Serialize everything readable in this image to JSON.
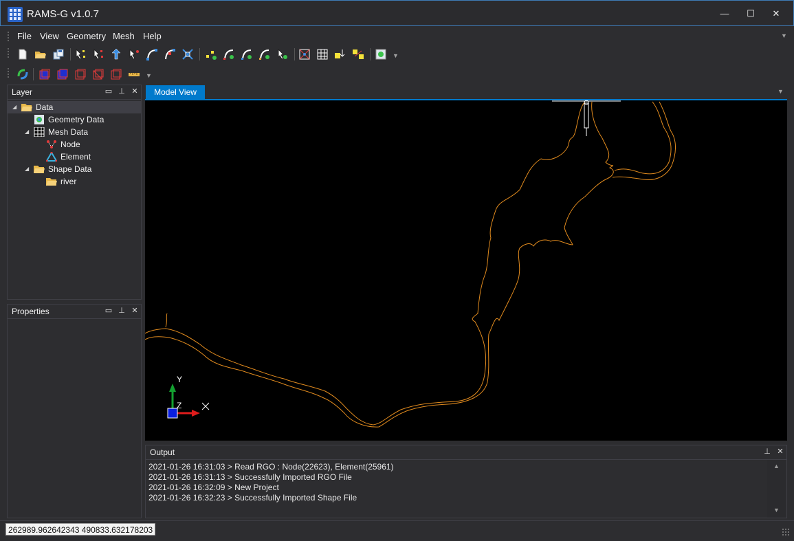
{
  "window": {
    "title": "RAMS-G v1.0.7",
    "min_glyph": "—",
    "max_glyph": "☐",
    "close_glyph": "✕"
  },
  "menu": {
    "items": [
      "File",
      "View",
      "Geometry",
      "Mesh",
      "Help"
    ]
  },
  "toolbar": {
    "row1_icons": [
      "new-file-icon",
      "open-folder-icon",
      "save-icon",
      "select-node-icon",
      "deselect-node-icon",
      "move-node-icon",
      "edit-node-icon",
      "add-line-icon",
      "split-line-icon",
      "delete-line-icon",
      "add-point-icon",
      "curve-add-icon",
      "curve-edit-icon",
      "curve-merge-icon",
      "curve-delete-icon",
      "mesh-region-icon",
      "mesh-grid-icon",
      "mesh-import-icon",
      "mesh-export-icon",
      "map-view-icon"
    ],
    "row2_icons": [
      "refresh-icon",
      "layer-blue-1-icon",
      "layer-blue-2-icon",
      "layer-red-1-icon",
      "layer-red-2-icon",
      "layer-red-3-icon",
      "ruler-icon"
    ]
  },
  "layer_panel": {
    "title": "Layer",
    "tree": [
      {
        "label": "Data",
        "level": 0,
        "expanded": true,
        "icon": "folder-open-icon",
        "selected": true
      },
      {
        "label": "Geometry Data",
        "level": 1,
        "icon": "geometry-icon"
      },
      {
        "label": "Mesh Data",
        "level": 1,
        "expanded": true,
        "icon": "mesh-icon"
      },
      {
        "label": "Node",
        "level": 2,
        "icon": "node-icon"
      },
      {
        "label": "Element",
        "level": 2,
        "icon": "element-icon"
      },
      {
        "label": "Shape Data",
        "level": 1,
        "expanded": true,
        "icon": "folder-open-icon"
      },
      {
        "label": "river",
        "level": 2,
        "icon": "folder-icon"
      }
    ]
  },
  "properties_panel": {
    "title": "Properties"
  },
  "model_view": {
    "tab_label": "Model View",
    "axis": {
      "y": "Y",
      "z": "Z",
      "x": "X"
    },
    "colors": {
      "outline": "#e08a1e",
      "background": "#000000"
    }
  },
  "output_panel": {
    "title": "Output",
    "lines": [
      "2021-01-26 16:31:03 > Read RGO : Node(22623), Element(25961)",
      "2021-01-26 16:31:13 > Successfully Imported RGO File",
      "2021-01-26 16:32:09 > New Project",
      "2021-01-26 16:32:23 > Successfully Imported Shape File"
    ]
  },
  "status": {
    "coordinates": "262989.962642343 490833.632178203"
  },
  "colors": {
    "accent": "#007acc",
    "chrome": "#2d2d30"
  }
}
